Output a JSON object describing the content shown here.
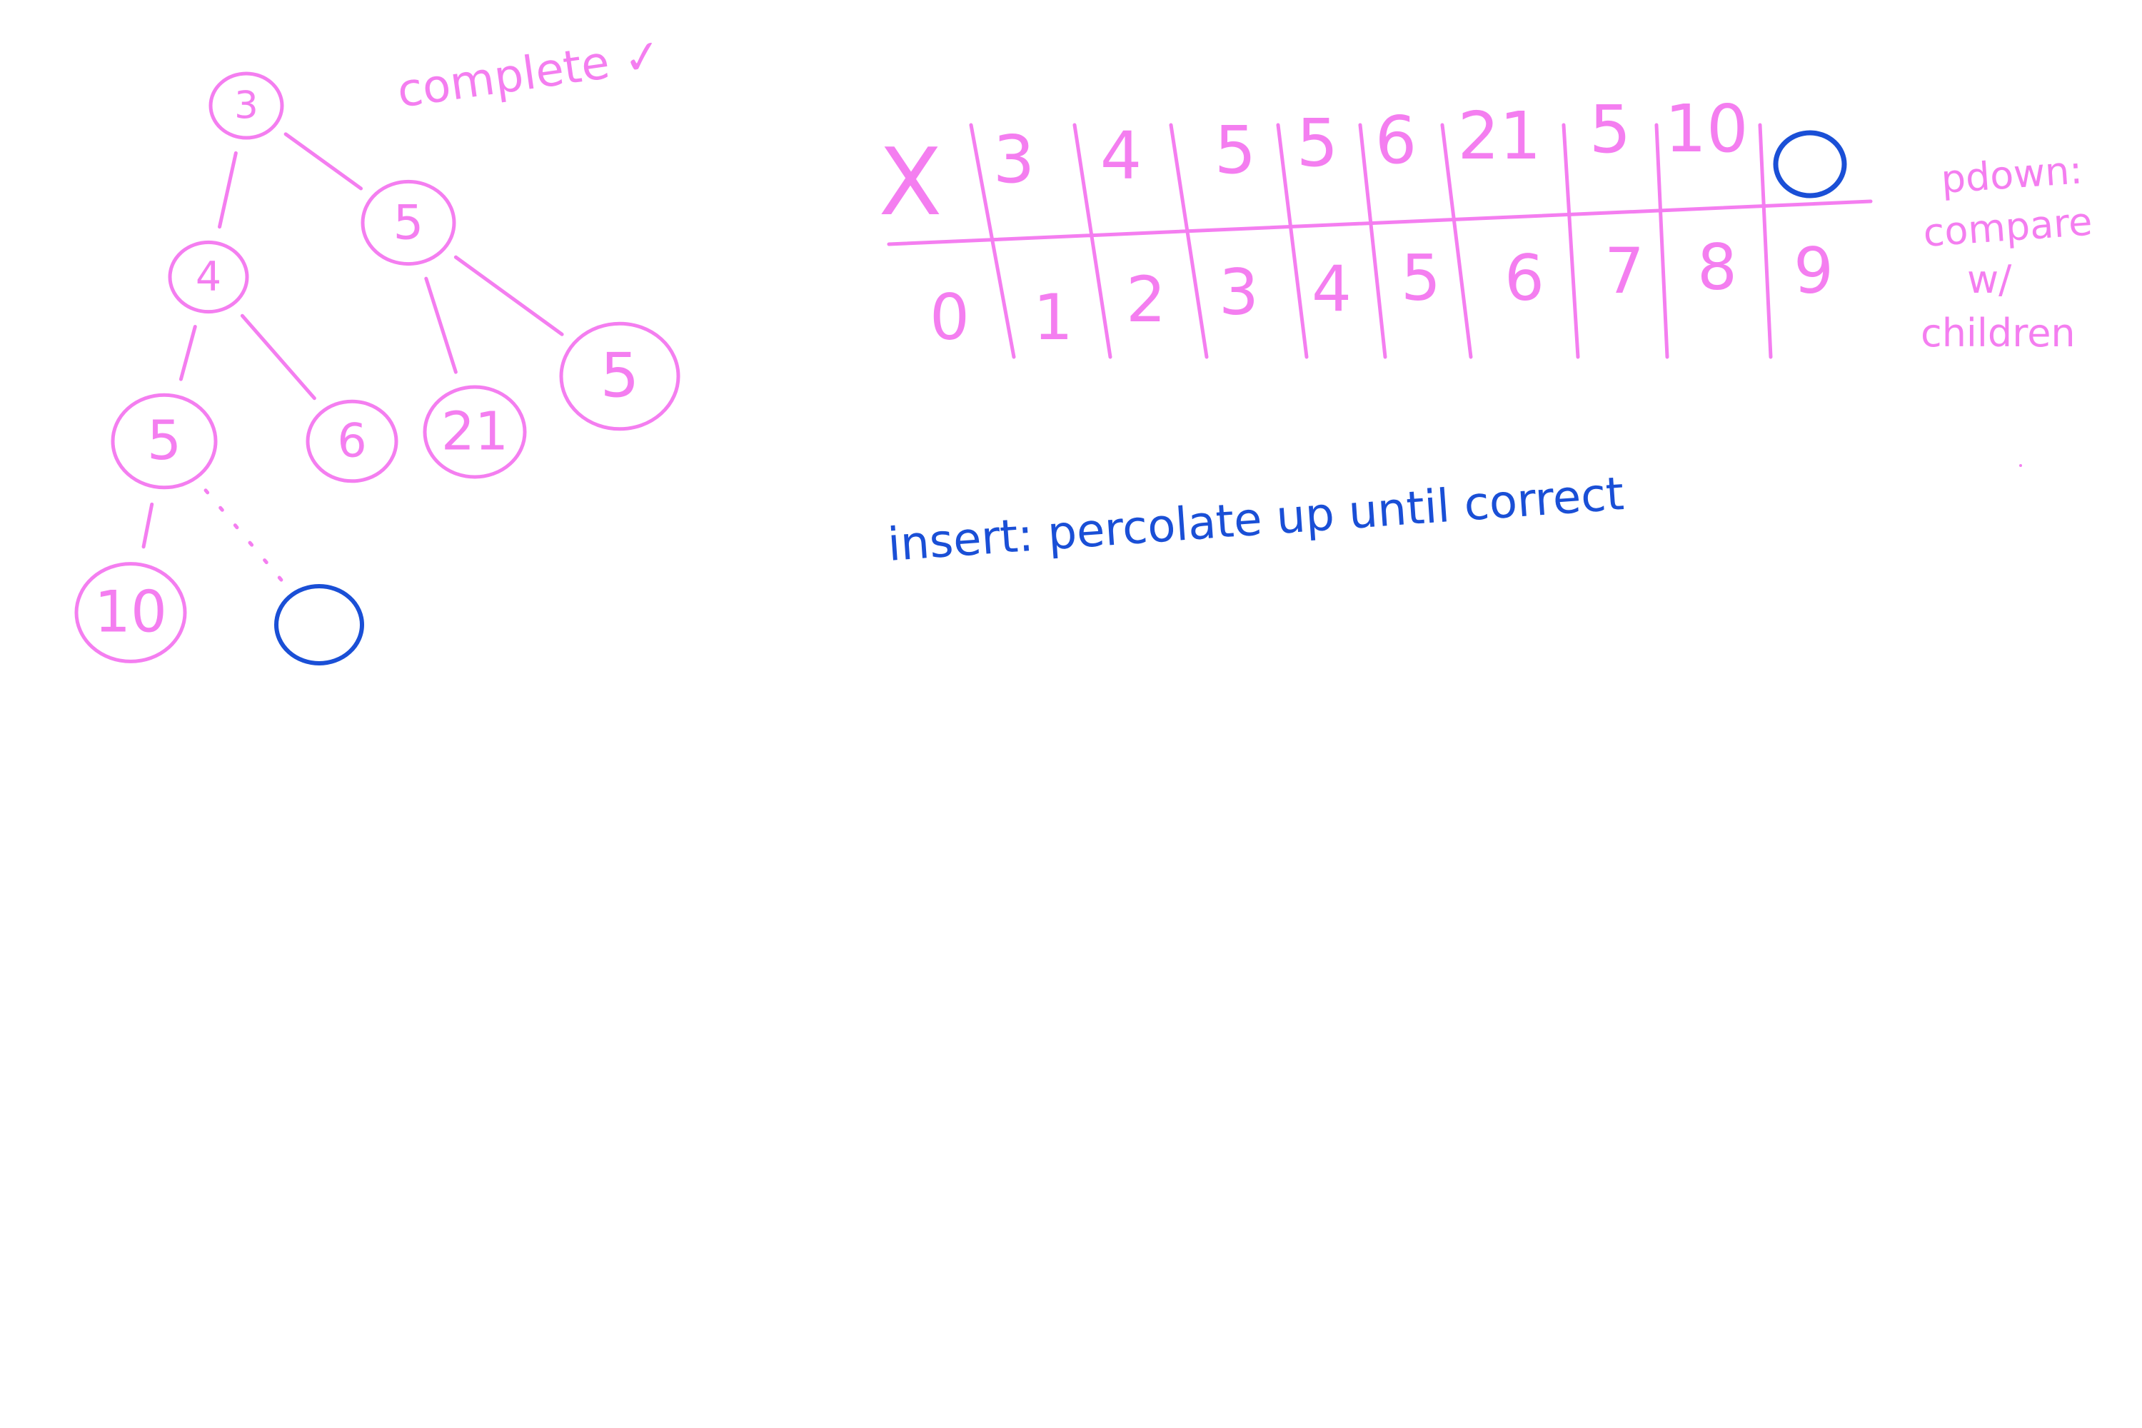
{
  "colors": {
    "pink": "#f47ef0",
    "blue": "#1a4fd6",
    "background": "#ffffff"
  },
  "tree": {
    "nodes": [
      {
        "id": "n1",
        "value": "3",
        "color": "pink"
      },
      {
        "id": "n2",
        "value": "4",
        "color": "pink"
      },
      {
        "id": "n3",
        "value": "5",
        "color": "pink"
      },
      {
        "id": "n4",
        "value": "5",
        "color": "pink"
      },
      {
        "id": "n5",
        "value": "6",
        "color": "pink"
      },
      {
        "id": "n6",
        "value": "21",
        "color": "pink"
      },
      {
        "id": "n7",
        "value": "5",
        "color": "pink"
      },
      {
        "id": "n8",
        "value": "10",
        "color": "pink"
      },
      {
        "id": "n9",
        "value": "",
        "color": "blue"
      }
    ],
    "edges": [
      [
        "n1",
        "n2"
      ],
      [
        "n1",
        "n3"
      ],
      [
        "n2",
        "n4"
      ],
      [
        "n2",
        "n5"
      ],
      [
        "n3",
        "n6"
      ],
      [
        "n3",
        "n7"
      ],
      [
        "n4",
        "n8"
      ]
    ],
    "dashed_edges": [
      [
        "n4",
        "n9"
      ]
    ]
  },
  "notes": {
    "complete": "complete ✓",
    "insert": "insert: percolate up until correct",
    "pdown_line1": "pdown:",
    "pdown_line2": "compare",
    "pdown_line3": "w/",
    "pdown_line4": "children"
  },
  "array": {
    "values": [
      "X",
      "3",
      "4",
      "5",
      "5",
      "6",
      "21",
      "5",
      "10",
      ""
    ],
    "indices": [
      "0",
      "1",
      "2",
      "3",
      "4",
      "5",
      "6",
      "7",
      "8",
      "9"
    ],
    "new_slot_index": 9
  }
}
